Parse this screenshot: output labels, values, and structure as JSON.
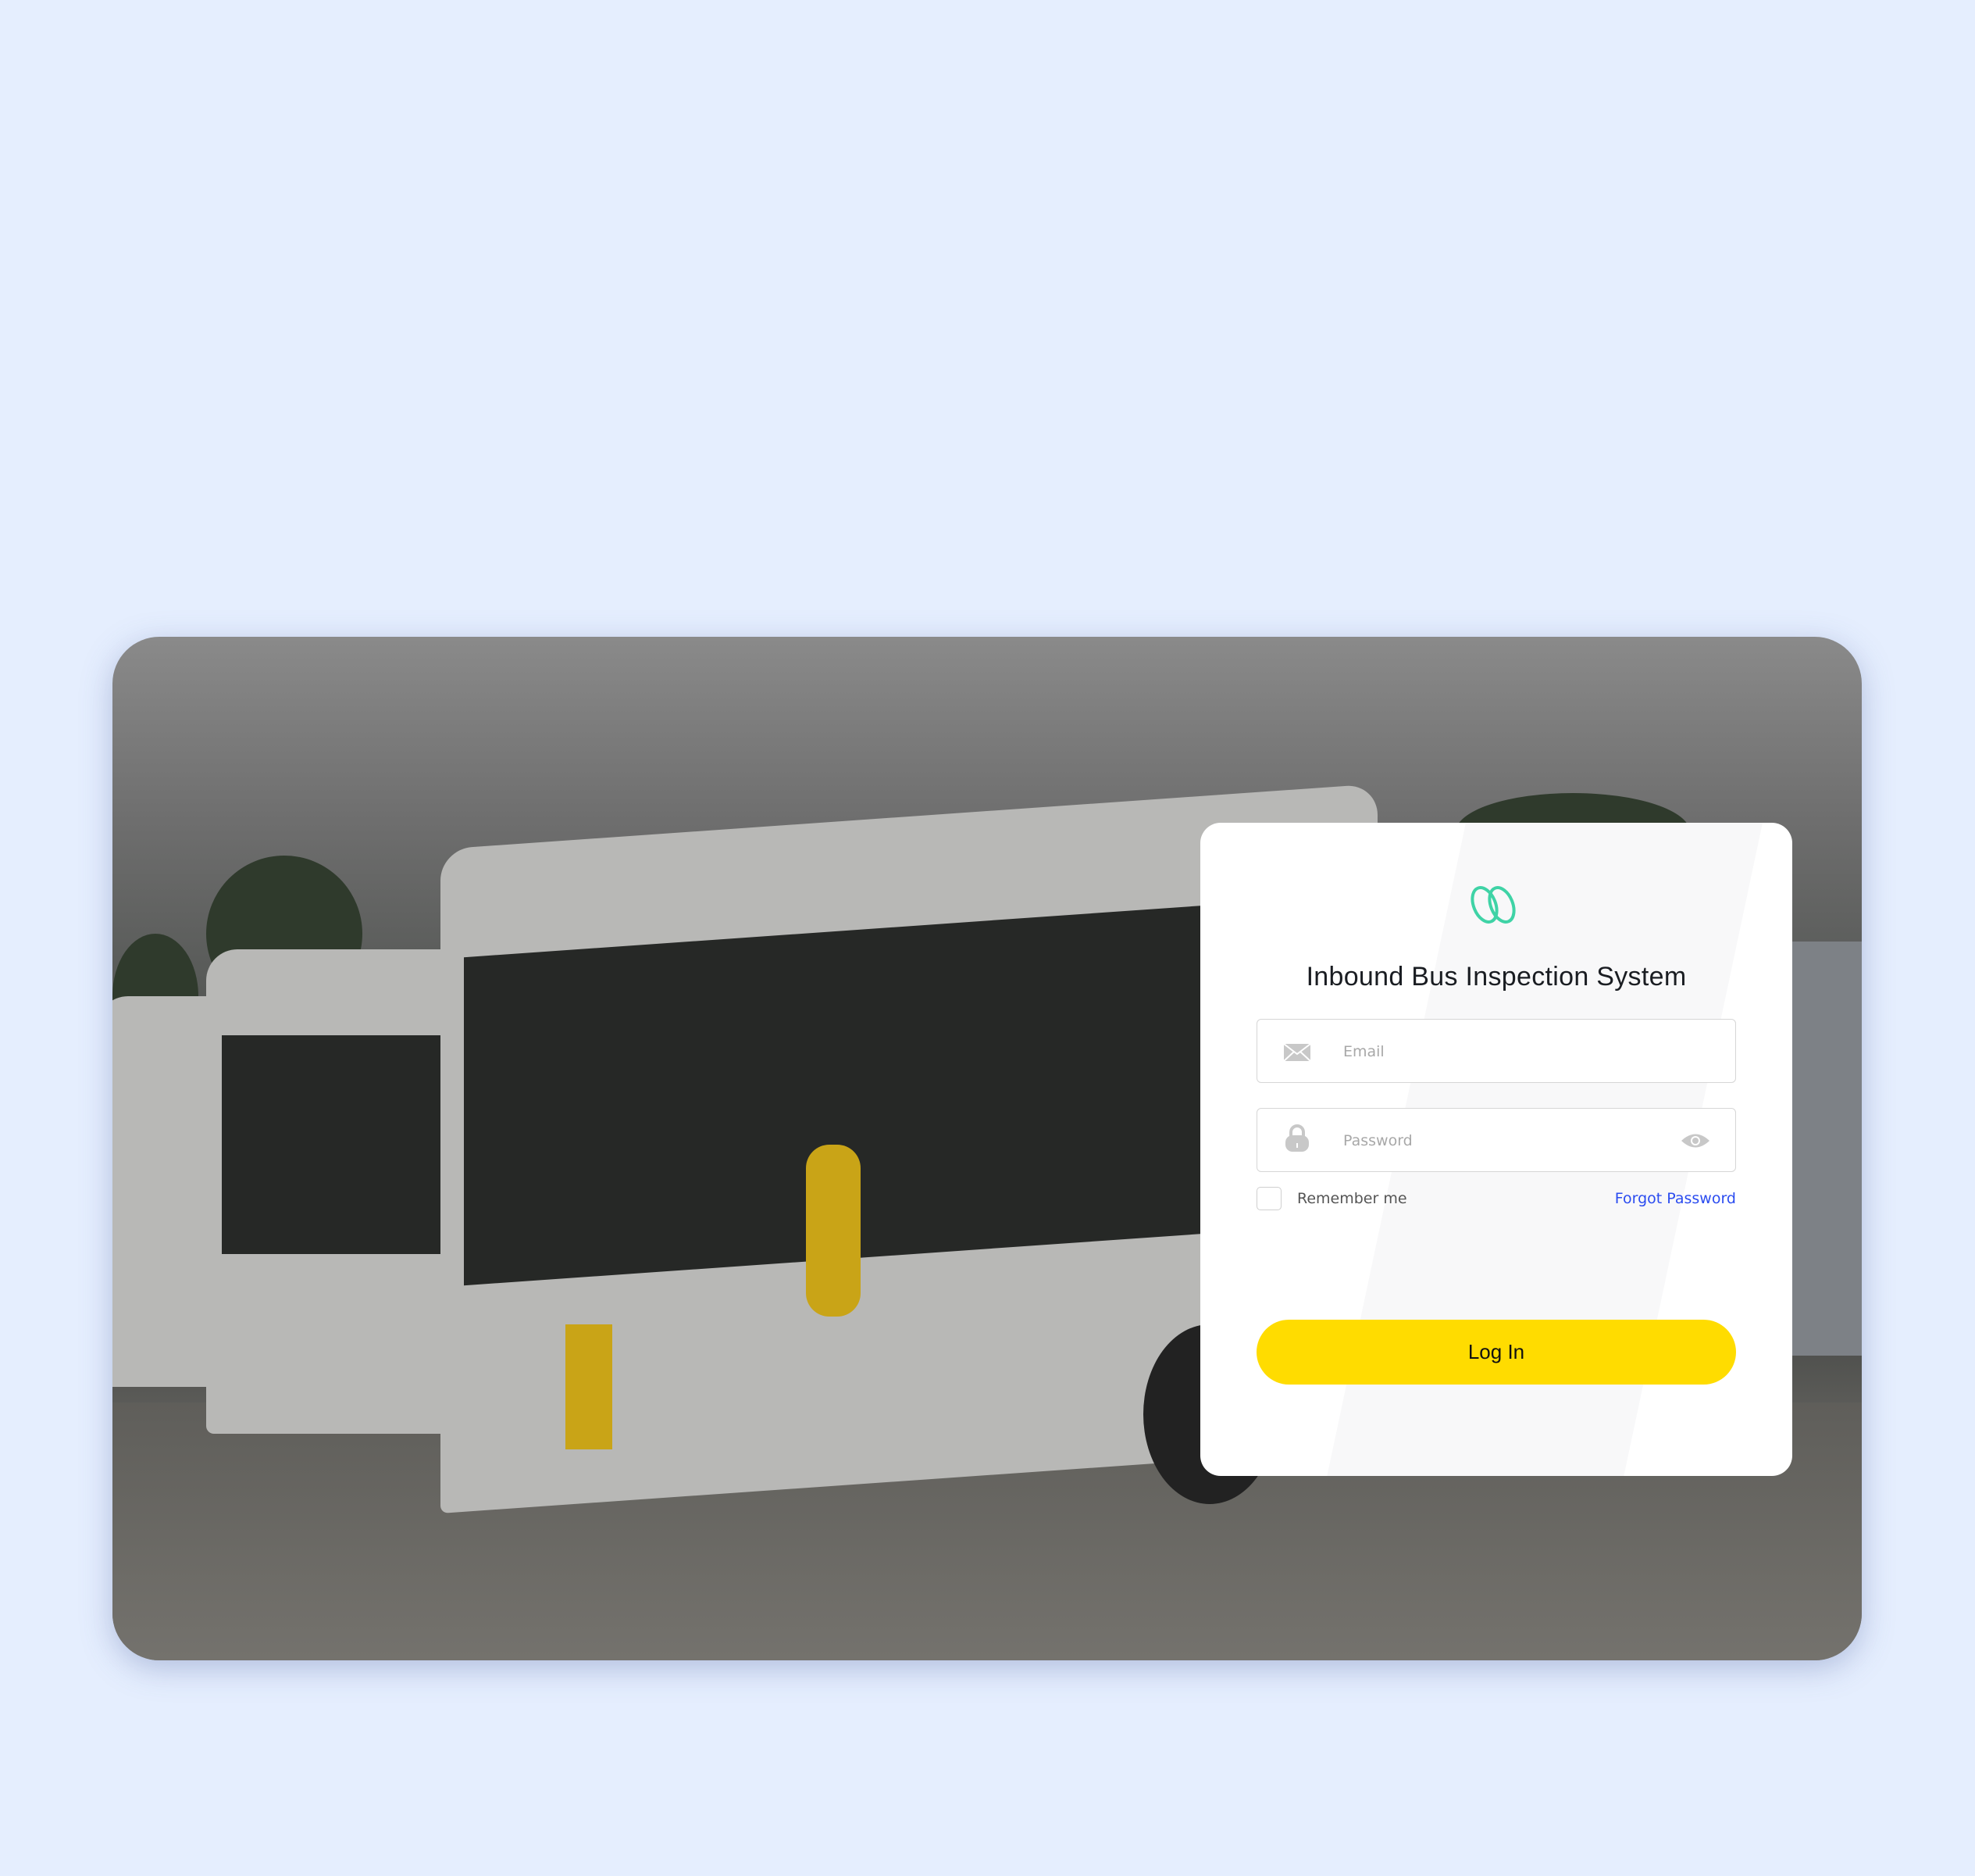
{
  "login": {
    "title": "Inbound Bus Inspection System",
    "email_placeholder": "Email",
    "email_value": "",
    "password_placeholder": "Password",
    "password_value": "",
    "remember_label": "Remember me",
    "remember_checked": false,
    "forgot_label": "Forgot Password",
    "login_label": "Log In"
  },
  "icons": {
    "logo": "double-loop-logo",
    "email": "envelope-icon",
    "password": "lock-icon",
    "toggle": "eye-icon"
  },
  "colors": {
    "page_bg": "#e5eefe",
    "accent": "#ffdc00",
    "logo": "#3fd3a6",
    "link": "#2b4cf0"
  }
}
